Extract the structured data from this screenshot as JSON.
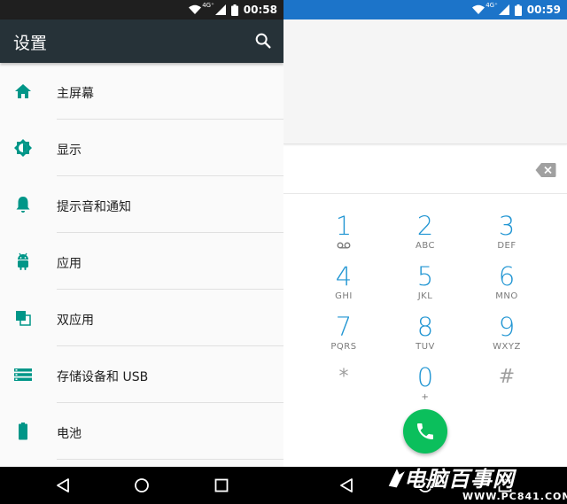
{
  "left": {
    "statusbar": {
      "network": "4G⁺",
      "time": "00:58"
    },
    "toolbar": {
      "title": "设置",
      "search_icon": "search-icon"
    },
    "items": [
      {
        "label": "主屏幕",
        "icon": "home-icon"
      },
      {
        "label": "显示",
        "icon": "brightness-icon"
      },
      {
        "label": "提示音和通知",
        "icon": "bell-icon"
      },
      {
        "label": "应用",
        "icon": "android-icon"
      },
      {
        "label": "双应用",
        "icon": "dual-app-icon"
      },
      {
        "label": "存储设备和 USB",
        "icon": "storage-icon"
      },
      {
        "label": "电池",
        "icon": "battery-icon"
      }
    ]
  },
  "right": {
    "statusbar": {
      "network": "4G⁺",
      "time": "00:59"
    },
    "keypad": [
      {
        "num": "1",
        "sub": ""
      },
      {
        "num": "2",
        "sub": "ABC"
      },
      {
        "num": "3",
        "sub": "DEF"
      },
      {
        "num": "4",
        "sub": "GHI"
      },
      {
        "num": "5",
        "sub": "JKL"
      },
      {
        "num": "6",
        "sub": "MNO"
      },
      {
        "num": "7",
        "sub": "PQRS"
      },
      {
        "num": "8",
        "sub": "TUV"
      },
      {
        "num": "9",
        "sub": "WXYZ"
      },
      {
        "num": "*",
        "sub": ""
      },
      {
        "num": "0",
        "sub": "+"
      },
      {
        "num": "#",
        "sub": ""
      }
    ]
  },
  "watermark": {
    "main": "电脑百事网",
    "sub": "WWW.PC841.COM"
  },
  "colors": {
    "accent": "#009688",
    "toolbar": "#263238",
    "dialer_statusbar": "#1c74c9",
    "dialer_digit": "#2296d3",
    "call_button": "#0bbf5c"
  }
}
